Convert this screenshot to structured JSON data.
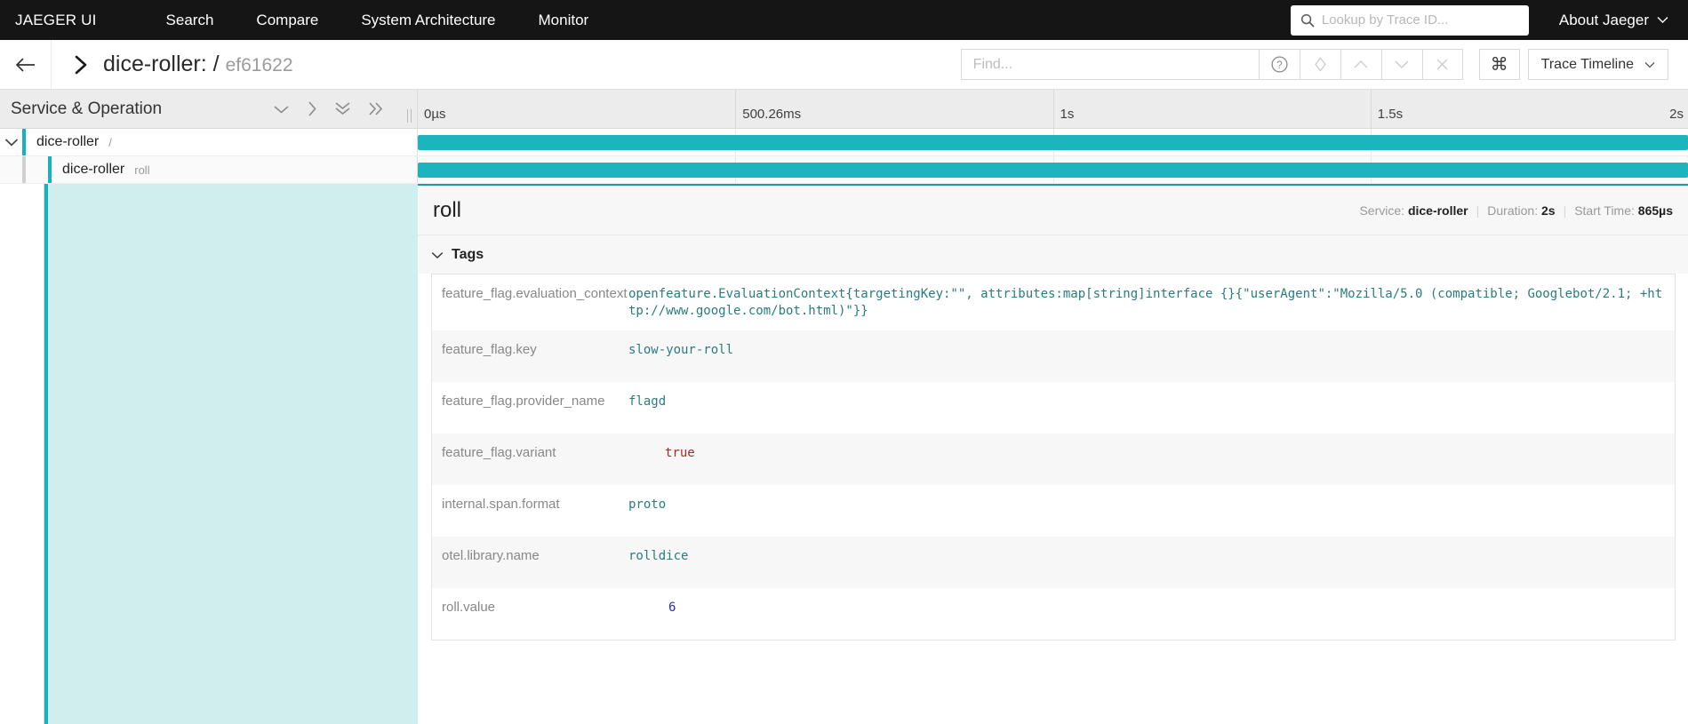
{
  "top_nav": {
    "brand": "JAEGER UI",
    "links": [
      {
        "label": "Search"
      },
      {
        "label": "Compare"
      },
      {
        "label": "System Architecture"
      },
      {
        "label": "Monitor"
      }
    ],
    "trace_lookup": {
      "placeholder": "Lookup by Trace ID...",
      "value": "",
      "icon": "search-icon"
    },
    "about": {
      "label": "About Jaeger",
      "icon": "chevron-down-icon"
    }
  },
  "toolbar": {
    "back_icon": "arrow-left-icon",
    "expand_icon": "chevron-right-icon",
    "trace_name": "dice-roller: /",
    "trace_id": "ef61622",
    "find": {
      "placeholder": "Find...",
      "value": ""
    },
    "help_icon": "question-circle-icon",
    "focus_icon": "diamond-icon",
    "prev_icon": "chevron-up-icon",
    "next_icon": "chevron-down-icon",
    "clear_icon": "close-icon",
    "keyboard_icon": "command-key-icon",
    "view_select": {
      "label": "Trace Timeline",
      "icon": "chevron-down-icon"
    }
  },
  "timeline_header": {
    "column_label": "Service & Operation",
    "controls": [
      {
        "name": "collapse-one-icon",
        "glyph": "chevron-down"
      },
      {
        "name": "expand-one-icon",
        "glyph": "chevron-right"
      },
      {
        "name": "collapse-all-icon",
        "glyph": "double-chevron-down"
      },
      {
        "name": "expand-all-icon",
        "glyph": "double-chevron-right"
      }
    ],
    "ticks": [
      {
        "label": "0µs",
        "pct": 0
      },
      {
        "label": "500.26ms",
        "pct": 25
      },
      {
        "label": "1s",
        "pct": 50
      },
      {
        "label": "1.5s",
        "pct": 75
      },
      {
        "label": "2s",
        "pct": 100
      }
    ]
  },
  "spans": [
    {
      "service": "dice-roller",
      "operation": "/",
      "depth": 0,
      "has_children": true,
      "expanded": true,
      "bar_left_pct": 0,
      "bar_width_pct": 100,
      "color": "#1cb5bd"
    },
    {
      "service": "dice-roller",
      "operation": "roll",
      "depth": 1,
      "has_children": false,
      "expanded": false,
      "bar_left_pct": 0,
      "bar_width_pct": 100,
      "color": "#1cb5bd"
    }
  ],
  "detail": {
    "operation_name": "roll",
    "meta": {
      "service_label": "Service:",
      "service_value": "dice-roller",
      "duration_label": "Duration:",
      "duration_value": "2s",
      "start_label": "Start Time:",
      "start_value": "865µs"
    },
    "tags_section": {
      "title": "Tags",
      "icon": "chevron-down-icon"
    },
    "tags": [
      {
        "key": "feature_flag.evaluation_context",
        "value": "openfeature.EvaluationContext{targetingKey:\"\", attributes:map[string]interface {}{\"userAgent\":\"Mozilla/5.0 (compatible; Googlebot/2.1; +http://www.google.com/bot.html)\"}}",
        "type": "string"
      },
      {
        "key": "feature_flag.key",
        "value": "slow-your-roll",
        "type": "string"
      },
      {
        "key": "feature_flag.provider_name",
        "value": "flagd",
        "type": "string"
      },
      {
        "key": "feature_flag.variant",
        "value": "true",
        "type": "bool"
      },
      {
        "key": "internal.span.format",
        "value": "proto",
        "type": "string"
      },
      {
        "key": "otel.library.name",
        "value": "rolldice",
        "type": "string"
      },
      {
        "key": "roll.value",
        "value": "6",
        "type": "number"
      }
    ]
  },
  "colors": {
    "nav_background": "#151515",
    "span_bar": "#1cb5bd",
    "accent_teal": "#17b3bb",
    "detail_tint": "#d0eeee",
    "string_value": "#2a7b7e",
    "bool_value": "#a5292a",
    "number_value": "#2b2bbd"
  }
}
